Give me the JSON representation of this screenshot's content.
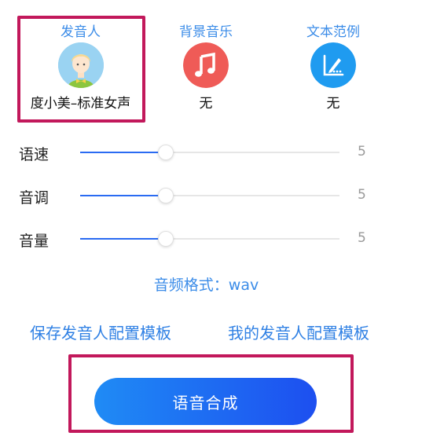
{
  "top_options": {
    "speaker": {
      "label": "发音人",
      "value": "度小美–标准女声",
      "icon": "child-avatar-icon"
    },
    "music": {
      "label": "背景音乐",
      "value": "无",
      "icon": "music-note-icon",
      "color": "#ef5b57"
    },
    "text": {
      "label": "文本范例",
      "value": "无",
      "icon": "pen-document-icon",
      "color": "#1f9bf0"
    }
  },
  "sliders": [
    {
      "name": "语速",
      "value": "5",
      "level": 0.33
    },
    {
      "name": "音调",
      "value": "5",
      "level": 0.33
    },
    {
      "name": "音量",
      "value": "5",
      "level": 0.33
    }
  ],
  "format_text": "音频格式：wav",
  "links": {
    "save_template": "保存发音人配置模板",
    "my_template": "我的发音人配置模板"
  },
  "synth_button": "语音合成",
  "colors": {
    "accent": "#3b8ce8",
    "slider": "#2a6bf2",
    "highlight": "#c2185b",
    "button_start": "#1f8bf5",
    "button_end": "#1d4ff0"
  }
}
